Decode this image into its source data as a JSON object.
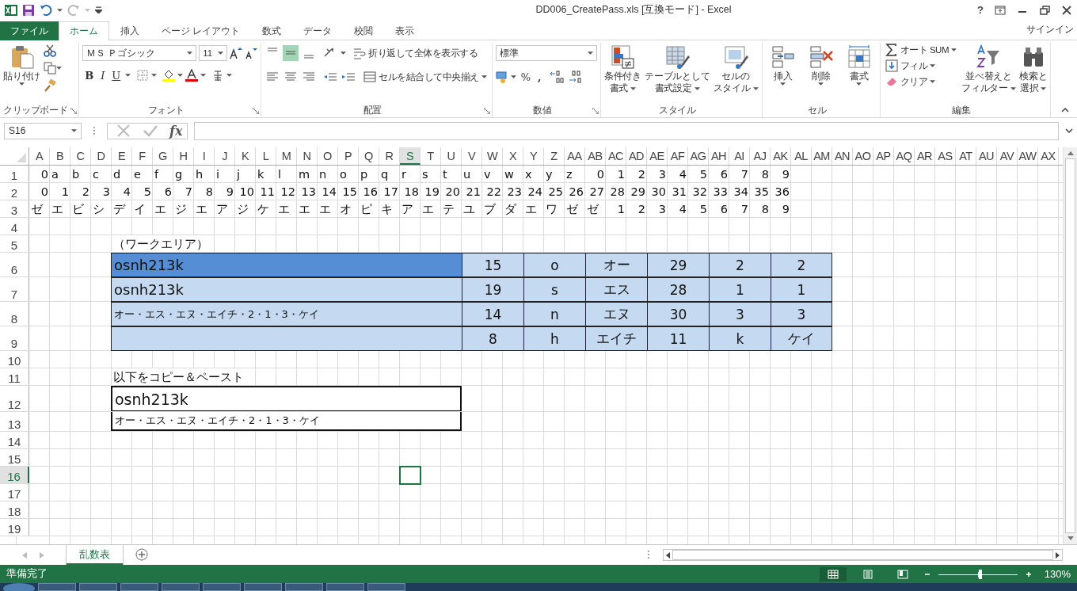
{
  "window": {
    "title": "DD006_CreatePass.xls  [互換モード] - Excel",
    "help": "?"
  },
  "tabs": [
    {
      "label": "ファイル",
      "selected": false,
      "kind": "file"
    },
    {
      "label": "ホーム",
      "selected": true,
      "kind": "tab"
    },
    {
      "label": "挿入",
      "selected": false,
      "kind": "tab"
    },
    {
      "label": "ページ レイアウト",
      "selected": false,
      "kind": "tab"
    },
    {
      "label": "数式",
      "selected": false,
      "kind": "tab"
    },
    {
      "label": "データ",
      "selected": false,
      "kind": "tab"
    },
    {
      "label": "校閲",
      "selected": false,
      "kind": "tab"
    },
    {
      "label": "表示",
      "selected": false,
      "kind": "tab"
    }
  ],
  "signin": "サインイン",
  "ribbon": {
    "clipboard": {
      "label": "クリップボード",
      "paste": "貼り付け"
    },
    "font": {
      "label": "フォント",
      "face": "ＭＳ Ｐゴシック",
      "size": "11",
      "bold": "B",
      "italic": "I",
      "underline": "U"
    },
    "alignment": {
      "label": "配置",
      "wrap": "折り返して全体を表示する",
      "merge": "セルを結合して中央揃え",
      "middle_on": true
    },
    "number": {
      "label": "数値",
      "format": "標準",
      "percent": "%",
      "comma": ","
    },
    "styles": {
      "label": "スタイル",
      "conditional": [
        "条件付き",
        "書式"
      ],
      "table": [
        "テーブルとして",
        "書式設定"
      ],
      "cell": [
        "セルの",
        "スタイル"
      ]
    },
    "cells": {
      "label": "セル",
      "insert": "挿入",
      "delete": "削除",
      "format": "書式"
    },
    "editing": {
      "label": "編集",
      "autosum": "オート SUM",
      "fill": "フィル",
      "clear": "クリア",
      "sort": [
        "並べ替えと",
        "フィルター"
      ],
      "find": [
        "検索と",
        "選択"
      ]
    }
  },
  "formula_bar": {
    "name_box": "S16",
    "function_label": "fx"
  },
  "columns": [
    {
      "label": "A",
      "selected": false
    },
    {
      "label": "B",
      "selected": false
    },
    {
      "label": "C",
      "selected": false
    },
    {
      "label": "D",
      "selected": false
    },
    {
      "label": "E",
      "selected": false
    },
    {
      "label": "F",
      "selected": false
    },
    {
      "label": "G",
      "selected": false
    },
    {
      "label": "H",
      "selected": false
    },
    {
      "label": "I",
      "selected": false
    },
    {
      "label": "J",
      "selected": false
    },
    {
      "label": "K",
      "selected": false
    },
    {
      "label": "L",
      "selected": false
    },
    {
      "label": "M",
      "selected": false
    },
    {
      "label": "N",
      "selected": false
    },
    {
      "label": "O",
      "selected": false
    },
    {
      "label": "P",
      "selected": false
    },
    {
      "label": "Q",
      "selected": false
    },
    {
      "label": "R",
      "selected": false
    },
    {
      "label": "S",
      "selected": true
    },
    {
      "label": "T",
      "selected": false
    },
    {
      "label": "U",
      "selected": false
    },
    {
      "label": "V",
      "selected": false
    },
    {
      "label": "W",
      "selected": false
    },
    {
      "label": "X",
      "selected": false
    },
    {
      "label": "Y",
      "selected": false
    },
    {
      "label": "Z",
      "selected": false
    },
    {
      "label": "AA",
      "selected": false
    },
    {
      "label": "AB",
      "selected": false
    },
    {
      "label": "AC",
      "selected": false
    },
    {
      "label": "AD",
      "selected": false
    },
    {
      "label": "AE",
      "selected": false
    },
    {
      "label": "AF",
      "selected": false
    },
    {
      "label": "AG",
      "selected": false
    },
    {
      "label": "AH",
      "selected": false
    },
    {
      "label": "AI",
      "selected": false
    },
    {
      "label": "AJ",
      "selected": false
    },
    {
      "label": "AK",
      "selected": false
    },
    {
      "label": "AL",
      "selected": false
    },
    {
      "label": "AM",
      "selected": false
    },
    {
      "label": "AN",
      "selected": false
    },
    {
      "label": "AO",
      "selected": false
    },
    {
      "label": "AP",
      "selected": false
    },
    {
      "label": "AQ",
      "selected": false
    },
    {
      "label": "AR",
      "selected": false
    },
    {
      "label": "AS",
      "selected": false
    },
    {
      "label": "AT",
      "selected": false
    },
    {
      "label": "AU",
      "selected": false
    },
    {
      "label": "AV",
      "selected": false
    },
    {
      "label": "AW",
      "selected": false
    },
    {
      "label": "AX",
      "selected": false
    }
  ],
  "rows": [
    {
      "label": "1",
      "selected": false,
      "kind": "chars",
      "cells": [
        "0",
        "a",
        "b",
        "c",
        "d",
        "e",
        "f",
        "g",
        "h",
        "i",
        "j",
        "k",
        "l",
        "m",
        "n",
        "o",
        "p",
        "q",
        "r",
        "s",
        "t",
        "u",
        "v",
        "w",
        "x",
        "y",
        "z",
        "0",
        "1",
        "2",
        "3",
        "4",
        "5",
        "6",
        "7",
        "8",
        "9"
      ]
    },
    {
      "label": "2",
      "selected": false,
      "kind": "chars",
      "cells": [
        "0",
        "1",
        "2",
        "3",
        "4",
        "5",
        "6",
        "7",
        "8",
        "9",
        "10",
        "11",
        "12",
        "13",
        "14",
        "15",
        "16",
        "17",
        "18",
        "19",
        "20",
        "21",
        "22",
        "23",
        "24",
        "25",
        "26",
        "27",
        "28",
        "29",
        "30",
        "31",
        "32",
        "33",
        "34",
        "35",
        "36"
      ]
    },
    {
      "label": "3",
      "selected": false,
      "kind": "chars",
      "cells": [
        "ゼ",
        "エ",
        "ビ",
        "シ",
        "デ",
        "イ",
        "エ",
        "ジ",
        "エ",
        "ア",
        "ジ",
        "ケ",
        "エ",
        "エ",
        "エ",
        "オ",
        "ピ",
        "キ",
        "ア",
        "エ",
        "テ",
        "ユ",
        "ブ",
        "ダ",
        "エ",
        "ワ",
        "ゼ",
        "ゼ",
        "1",
        "2",
        "3",
        "4",
        "5",
        "6",
        "7",
        "8",
        "9"
      ]
    },
    {
      "label": "4",
      "selected": false,
      "kind": "blank"
    },
    {
      "label": "5",
      "selected": false,
      "kind": "note",
      "text": "（ワークエリア）"
    },
    {
      "label": "6",
      "selected": false,
      "kind": "work",
      "highlighted": true,
      "main": "osnh213k",
      "values": [
        "15",
        "o",
        "オー",
        "29",
        "2",
        "2"
      ]
    },
    {
      "label": "7",
      "selected": false,
      "kind": "work",
      "highlighted": false,
      "main": "osnh213k",
      "values": [
        "19",
        "s",
        "エス",
        "28",
        "1",
        "1"
      ]
    },
    {
      "label": "8",
      "selected": false,
      "kind": "work_reading",
      "highlighted": false,
      "main": "オー・エス・エヌ・エイチ・2・1・3・ケイ",
      "values": [
        "14",
        "n",
        "エヌ",
        "30",
        "3",
        "3"
      ]
    },
    {
      "label": "9",
      "selected": false,
      "kind": "work",
      "highlighted": false,
      "values": [
        "8",
        "h",
        "エイチ",
        "11",
        "k",
        "ケイ"
      ]
    },
    {
      "label": "10",
      "selected": false,
      "kind": "blank"
    },
    {
      "label": "11",
      "selected": false,
      "kind": "note",
      "text": "以下をコピー＆ペースト"
    },
    {
      "label": "12",
      "selected": false,
      "kind": "copy_password",
      "text": "osnh213k"
    },
    {
      "label": "13",
      "selected": false,
      "kind": "copy_reading",
      "text": "オー・エス・エヌ・エイチ・2・1・3・ケイ"
    },
    {
      "label": "14",
      "selected": false,
      "kind": "blank"
    },
    {
      "label": "15",
      "selected": false,
      "kind": "blank"
    },
    {
      "label": "16",
      "selected": true,
      "kind": "blank"
    },
    {
      "label": "17",
      "selected": false,
      "kind": "blank"
    },
    {
      "label": "18",
      "selected": false,
      "kind": "blank"
    },
    {
      "label": "19",
      "selected": false,
      "kind": "blank"
    }
  ],
  "sheet_tabs": [
    {
      "label": "乱数表",
      "selected": true
    }
  ],
  "status_bar": {
    "text": "準備完了",
    "zoom": {
      "level": 0.53,
      "label": "130%"
    }
  }
}
